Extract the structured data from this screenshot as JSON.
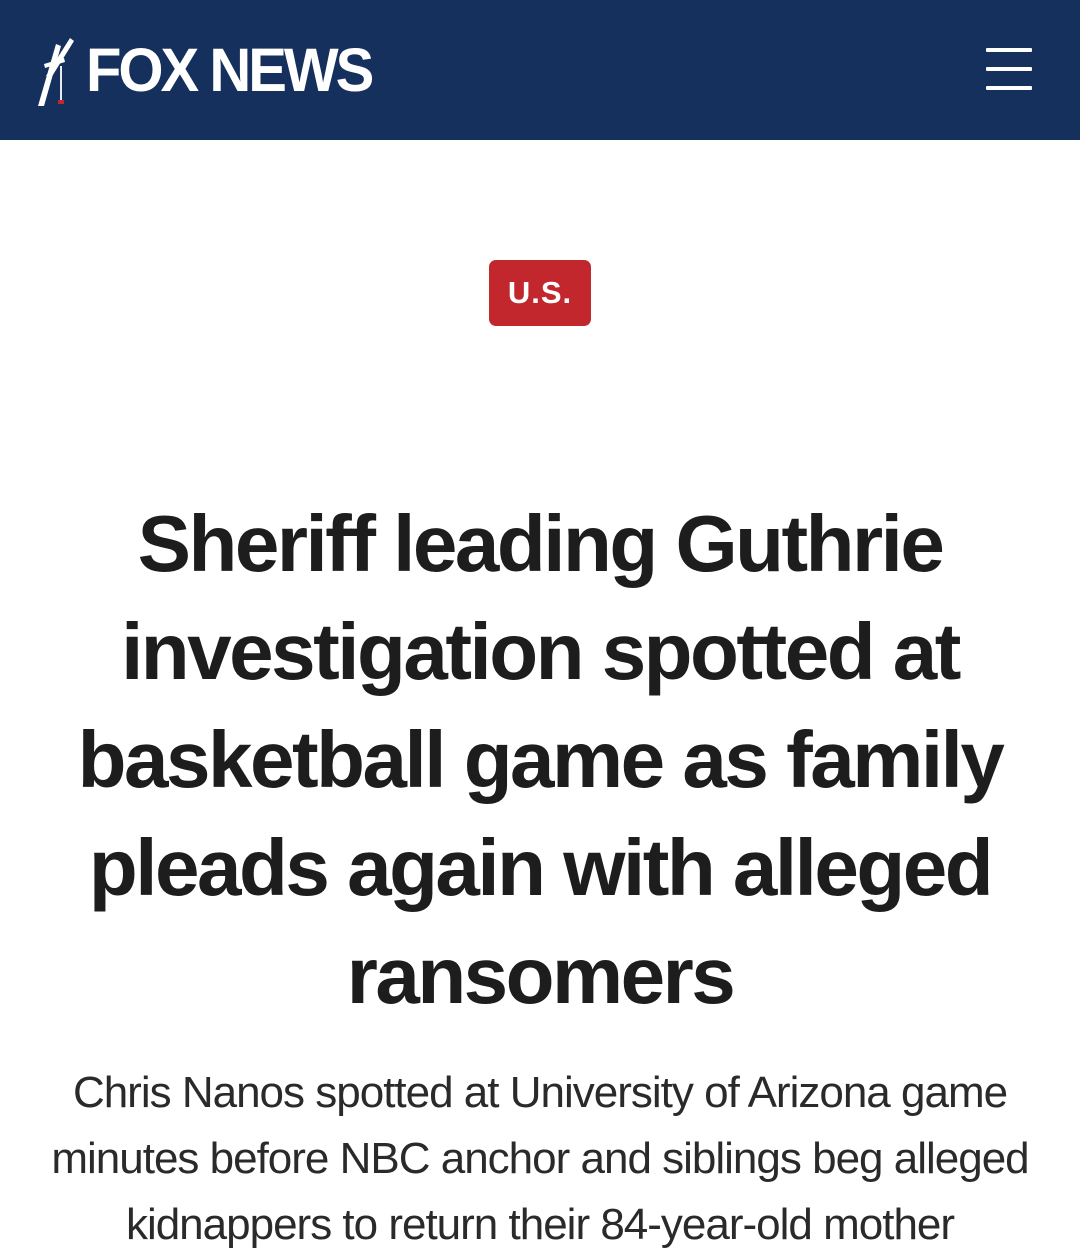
{
  "header": {
    "brand": "FOX NEWS",
    "logo_icon": "fox-news-searchlight-logo",
    "menu_icon": "hamburger-menu-icon",
    "background_color": "#15305c"
  },
  "article": {
    "category": "U.S.",
    "category_color": "#c1272d",
    "headline": "Sheriff leading Guthrie investigation spotted at basketball game as family pleads again with alleged ransomers",
    "subheadline": "Chris Nanos spotted at University of Arizona game minutes before NBC anchor and siblings beg alleged kidnappers to return their 84-year-old mother"
  }
}
